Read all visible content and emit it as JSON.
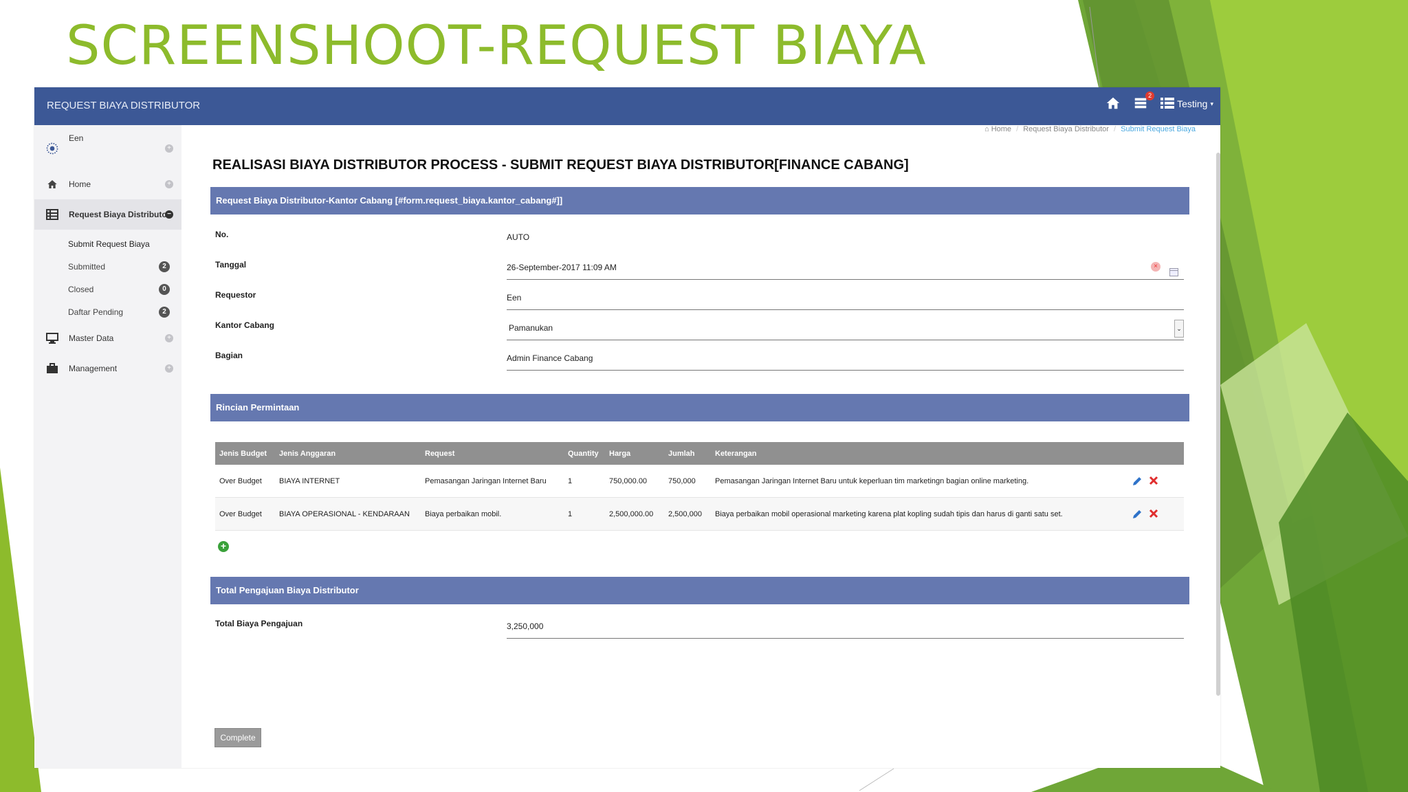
{
  "slide": {
    "title": "SCREENSHOOT-REQUEST BIAYA"
  },
  "navbar": {
    "brand": "REQUEST BIAYA DISTRIBUTOR",
    "notif_count": "2",
    "user_label": "Testing"
  },
  "sidebar": {
    "user": "Een",
    "items": [
      {
        "label": "Home",
        "icon": "home-icon"
      },
      {
        "label": "Request Biaya Distributor",
        "icon": "grid-icon"
      },
      {
        "label": "Master Data",
        "icon": "monitor-icon"
      },
      {
        "label": "Management",
        "icon": "briefcase-icon"
      }
    ],
    "subitems": [
      {
        "label": "Submit Request Biaya",
        "count": ""
      },
      {
        "label": "Submitted",
        "count": "2"
      },
      {
        "label": "Closed",
        "count": "0"
      },
      {
        "label": "Daftar Pending",
        "count": "2"
      }
    ]
  },
  "breadcrumb": [
    "Home",
    "Request Biaya Distributor",
    "Submit Request Biaya"
  ],
  "page": {
    "heading": "REALISASI BIAYA DISTRIBUTOR PROCESS - SUBMIT REQUEST BIAYA DISTRIBUTOR[FINANCE CABANG]"
  },
  "form": {
    "panel_title": "Request Biaya Distributor-Kantor Cabang [#form.request_biaya.kantor_cabang#]]",
    "fields": [
      {
        "label": "No.",
        "value": "AUTO"
      },
      {
        "label": "Tanggal",
        "value": "26-September-2017 11:09 AM"
      },
      {
        "label": "Requestor",
        "value": "Een"
      },
      {
        "label": "Kantor Cabang",
        "value": "Pamanukan"
      },
      {
        "label": "Bagian",
        "value": "Admin Finance Cabang"
      }
    ]
  },
  "rincian": {
    "panel_title": "Rincian Permintaan",
    "columns": [
      "Jenis Budget",
      "Jenis Anggaran",
      "Request",
      "Quantity",
      "Harga",
      "Jumlah",
      "Keterangan"
    ],
    "rows": [
      [
        "Over Budget",
        "BIAYA INTERNET",
        "Pemasangan Jaringan Internet Baru",
        "1",
        "750,000.00",
        "750,000",
        "Pemasangan Jaringan Internet Baru untuk keperluan tim marketingn bagian online marketing."
      ],
      [
        "Over Budget",
        "BIAYA OPERASIONAL - KENDARAAN",
        "Biaya perbaikan mobil.",
        "1",
        "2,500,000.00",
        "2,500,000",
        "Biaya perbaikan mobil operasional marketing karena plat kopling sudah tipis dan harus di ganti satu set."
      ]
    ]
  },
  "total": {
    "panel_title": "Total Pengajuan Biaya Distributor",
    "label": "Total Biaya Pengajuan",
    "value": "3,250,000"
  },
  "actions": {
    "complete_label": "Complete"
  },
  "colors": {
    "navbar": "#3c5896",
    "panel": "#6578b0",
    "title_green": "#8dbb2c"
  }
}
